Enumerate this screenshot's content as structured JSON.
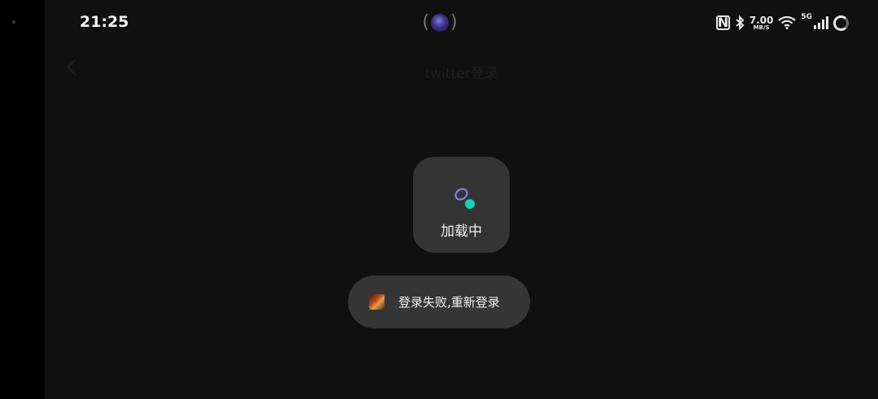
{
  "status_bar": {
    "time": "21:25",
    "net_speed_value": "7.00",
    "net_speed_unit": "MB/S",
    "network_type": "5G",
    "icons": [
      "nfc-icon",
      "bluetooth-icon",
      "wifi-icon",
      "signal-icon",
      "battery-ring-icon"
    ]
  },
  "header": {
    "back_icon": "chevron-left-icon",
    "title": "twitter登录"
  },
  "loading": {
    "text": "加载中",
    "accent_ring": "#8a86f2",
    "accent_dot": "#10d2b4"
  },
  "toast": {
    "message": "登录失败,重新登录"
  }
}
